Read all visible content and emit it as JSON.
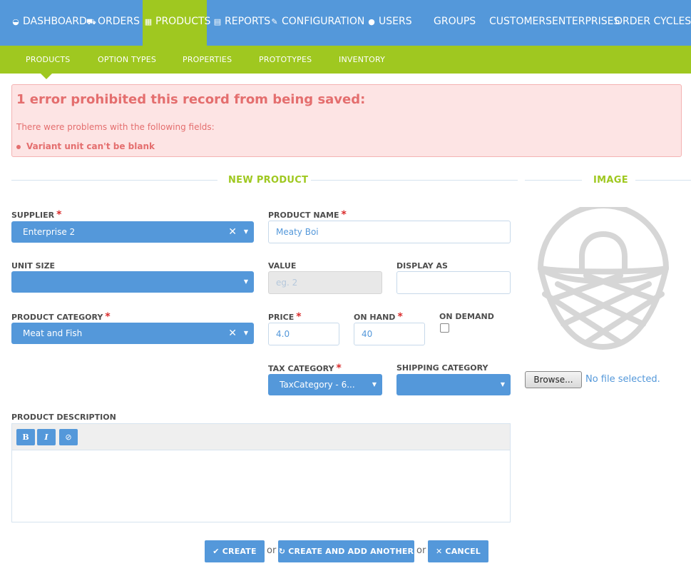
{
  "topnav": {
    "items": [
      {
        "label": "DASHBOARD",
        "icon": "dashboard-icon",
        "glyph": "◒"
      },
      {
        "label": "ORDERS",
        "icon": "cart-icon",
        "glyph": "⛟"
      },
      {
        "label": "PRODUCTS",
        "icon": "grid-icon",
        "glyph": "▦"
      },
      {
        "label": "REPORTS",
        "icon": "file-icon",
        "glyph": "▤"
      },
      {
        "label": "CONFIGURATION",
        "icon": "wrench-icon",
        "glyph": "✎"
      },
      {
        "label": "USERS",
        "icon": "user-icon",
        "glyph": "●"
      },
      {
        "label": "GROUPS"
      },
      {
        "label": "CUSTOMERS"
      },
      {
        "label": "ENTERPRISES"
      },
      {
        "label": "ORDER CYCLES"
      }
    ],
    "active": "PRODUCTS"
  },
  "subnav": {
    "items": [
      "PRODUCTS",
      "OPTION TYPES",
      "PROPERTIES",
      "PROTOTYPES",
      "INVENTORY"
    ]
  },
  "error": {
    "title": "1 error prohibited this record from being saved:",
    "subtitle": "There were problems with the following fields:",
    "item": "Variant unit can't be blank"
  },
  "sections": {
    "new_product": "NEW PRODUCT",
    "image": "IMAGE"
  },
  "form": {
    "supplier_label": "SUPPLIER",
    "supplier_value": "Enterprise 2",
    "product_name_label": "PRODUCT NAME",
    "product_name_value": "Meaty Boi",
    "unit_size_label": "UNIT SIZE",
    "unit_size_value": "",
    "value_label": "VALUE",
    "value_placeholder": "eg. 2",
    "display_as_label": "DISPLAY AS",
    "display_as_value": "",
    "category_label": "PRODUCT CATEGORY",
    "category_value": "Meat and Fish",
    "price_label": "PRICE",
    "price_value": "4.0",
    "on_hand_label": "ON HAND",
    "on_hand_value": "40",
    "on_demand_label": "ON DEMAND",
    "tax_label": "TAX CATEGORY",
    "tax_value": "TaxCategory - 6...",
    "shipping_label": "SHIPPING CATEGORY",
    "shipping_value": "",
    "description_label": "PRODUCT DESCRIPTION",
    "required_mark": "*",
    "clear_mark": "✕",
    "dropdown_mark": "▼"
  },
  "editor": {
    "bold": "B",
    "italic": "I",
    "clear": "⊘"
  },
  "upload": {
    "browse_label": "Browse...",
    "file_status": "No file selected."
  },
  "actions": {
    "create": "CREATE",
    "create_icon": "✔",
    "create_another": "CREATE AND ADD ANOTHER",
    "create_another_icon": "↻",
    "cancel": "CANCEL",
    "cancel_icon": "✕",
    "or": "or"
  },
  "colors": {
    "primary": "#5498da",
    "accent": "#9fc820",
    "error_bg": "#fde4e4",
    "error_text": "#e46e6e",
    "required": "#da2c2c"
  }
}
